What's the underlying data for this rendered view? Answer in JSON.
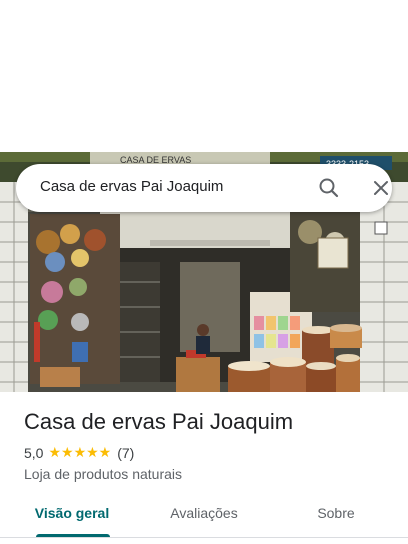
{
  "search": {
    "query": "Casa de ervas Pai Joaquim"
  },
  "hero": {
    "sign_text": "CASA DE ERVAS",
    "phone_fragment": "3333-2153"
  },
  "place": {
    "title": "Casa de ervas Pai Joaquim",
    "rating": "5,0",
    "stars": "★★★★★",
    "review_count": "(7)",
    "category": "Loja de produtos naturais"
  },
  "tabs": [
    {
      "label": "Visão geral",
      "active": true
    },
    {
      "label": "Avaliações",
      "active": false
    },
    {
      "label": "Sobre",
      "active": false
    }
  ],
  "colors": {
    "accent": "#01696f",
    "star": "#fbbc04"
  }
}
